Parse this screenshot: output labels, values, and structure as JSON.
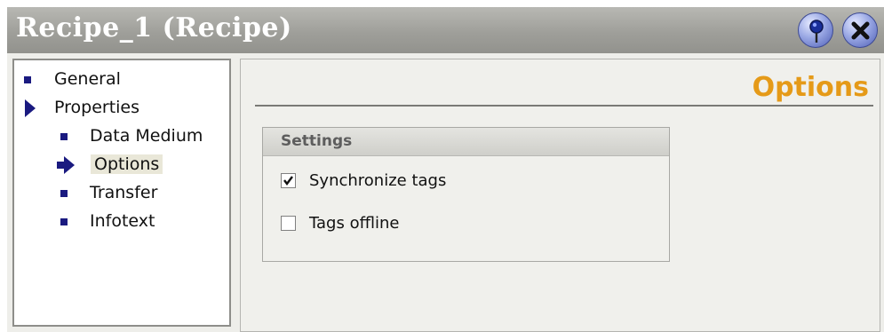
{
  "window": {
    "title": "Recipe_1 (Recipe)",
    "pin_button_icon": "pin-icon",
    "close_button_icon": "close-icon"
  },
  "nav": {
    "items": [
      {
        "label": "General",
        "icon": "bullet-square",
        "level": 0
      },
      {
        "label": "Properties",
        "icon": "expanded-arrow",
        "level": 0
      },
      {
        "label": "Data Medium",
        "icon": "bullet-square",
        "level": 1
      },
      {
        "label": "Options",
        "icon": "selected-arrow",
        "level": 1,
        "selected": true
      },
      {
        "label": "Transfer",
        "icon": "bullet-square",
        "level": 1
      },
      {
        "label": "Infotext",
        "icon": "bullet-square",
        "level": 1
      }
    ]
  },
  "content": {
    "heading": "Options",
    "settings_group": {
      "title": "Settings",
      "options": [
        {
          "label": "Synchronize tags",
          "checked": true
        },
        {
          "label": "Tags offline",
          "checked": false
        }
      ]
    }
  },
  "colors": {
    "heading_orange": "#e59a18",
    "bullet_navy": "#1a1a80",
    "titlebar_gray": "#9f9f9a"
  }
}
